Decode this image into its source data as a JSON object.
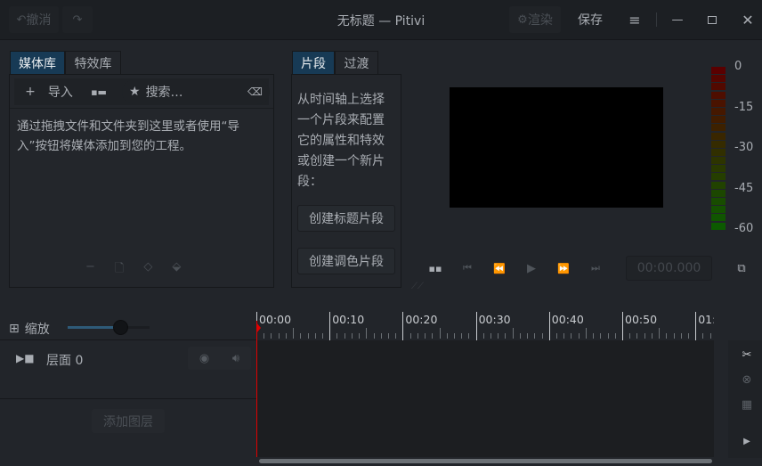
{
  "window": {
    "title": "无标题 — Pitivi"
  },
  "header": {
    "undo": "撤消",
    "render": "渲染",
    "save": "保存"
  },
  "left_tabs": [
    "媒体库",
    "特效库"
  ],
  "media": {
    "import": "导入",
    "search_placeholder": "搜索…",
    "empty_text_1": "通过拖拽文件和文件夹到这里或者使用“导",
    "empty_text_2": "入”按钮将媒体添加到您的工程。"
  },
  "clip_tabs": [
    "片段",
    "过渡"
  ],
  "clip": {
    "help": [
      "从时间轴上选择",
      "一个片段来配置",
      "它的属性和特效",
      "或创建一个新片",
      "段："
    ],
    "title_clip": "创建标题片段",
    "color_clip": "创建调色片段"
  },
  "viewer": {
    "timecode": "00:00.000"
  },
  "meter": {
    "labels": [
      "0",
      "-15",
      "-30",
      "-45",
      "-60"
    ],
    "colors": {
      "top": "#5a0000",
      "bottom": "#0c5a00"
    }
  },
  "timeline": {
    "zoom_label": "缩放",
    "zoom_level": 0.2,
    "ruler": [
      "00:00",
      "00:10",
      "00:20",
      "00:30",
      "00:40",
      "00:50",
      "01:"
    ],
    "layer": "层面 0",
    "add_layer": "添加图层",
    "playhead_color": "#e00000"
  }
}
